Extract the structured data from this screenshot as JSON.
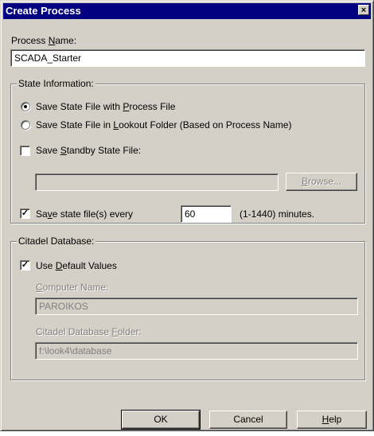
{
  "window": {
    "title": "Create Process",
    "close_glyph": "×"
  },
  "process_name": {
    "label_pre": "Process ",
    "label_key": "N",
    "label_post": "ame:",
    "value": "SCADA_Starter"
  },
  "state_information": {
    "title": "State Information:",
    "radio_with_process": {
      "pre": "Save State File with ",
      "key": "P",
      "post": "rocess File",
      "selected": true
    },
    "radio_lookout": {
      "pre": "Save State File in ",
      "key": "L",
      "post": "ookout Folder (Based on Process Name)",
      "selected": false
    },
    "standby": {
      "pre": "Save ",
      "key": "S",
      "post": "tandby State File:",
      "checked": false,
      "path_value": ""
    },
    "browse": {
      "key": "B",
      "post": "rowse..."
    },
    "save_every": {
      "pre": "Sa",
      "key": "v",
      "post": "e state file(s) every",
      "checked": true,
      "value": "60",
      "range": "(1-1440) minutes."
    }
  },
  "citadel": {
    "title": "Citadel Database:",
    "use_default": {
      "pre": "Use ",
      "key": "D",
      "post": "efault Values",
      "checked": true
    },
    "computer_name": {
      "key": "C",
      "post": "omputer Name:",
      "value": "PAROIKOS"
    },
    "folder": {
      "pre": "Citadel Database ",
      "key": "F",
      "post": "older:",
      "value": "f:\\look4\\database"
    }
  },
  "buttons": {
    "ok": "OK",
    "cancel": "Cancel",
    "help": {
      "key": "H",
      "post": "elp"
    }
  }
}
